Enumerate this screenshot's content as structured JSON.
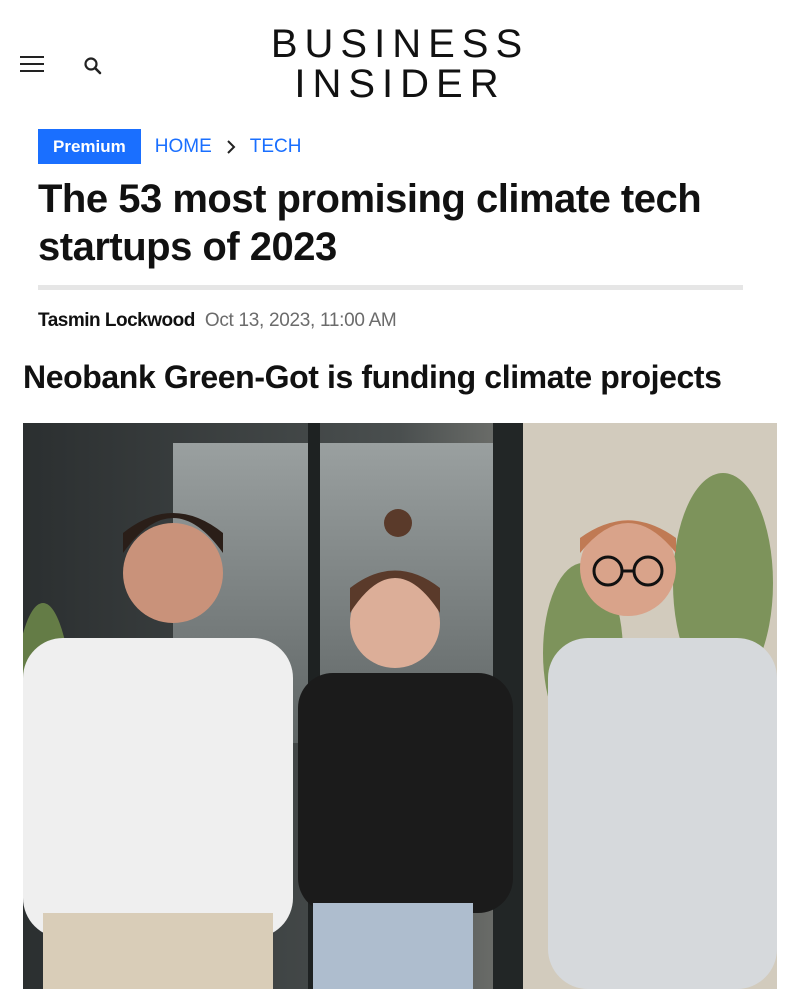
{
  "header": {
    "logo_line1": "BUSINESS",
    "logo_line2": "INSIDER",
    "menu_icon": "hamburger-menu-icon",
    "search_icon": "search-icon"
  },
  "breadcrumb": {
    "badge": "Premium",
    "items": [
      "HOME",
      "TECH"
    ]
  },
  "article": {
    "title": "The 53 most promising climate tech startups of 2023",
    "author": "Tasmin Lockwood",
    "date": "Oct 13, 2023, 11:00 AM",
    "section_heading": "Neobank Green-Got is funding climate projects"
  },
  "colors": {
    "accent": "#1a6fff",
    "text": "#111111",
    "muted": "#6b6b6b",
    "divider": "#e6e6e6"
  }
}
